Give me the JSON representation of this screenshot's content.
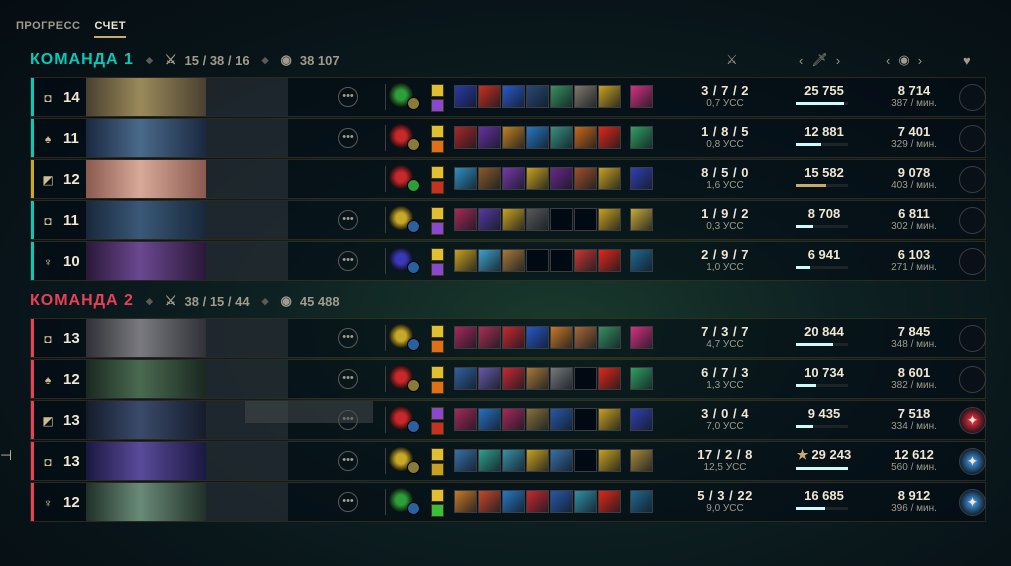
{
  "tabs": [
    {
      "label": "ПРОГРЕСС",
      "active": false
    },
    {
      "label": "СЧЕТ",
      "active": true
    }
  ],
  "teams": [
    {
      "name": "КОМАНДА 1",
      "color": "#0ac8b9",
      "kda": "15 / 38 / 16",
      "gold": "38 107",
      "players": [
        {
          "role": "top-icon",
          "role_glyph": "◘",
          "level": "14",
          "keystone": "#2d9e3a",
          "sub": "#8a7a3a",
          "spells": [
            "#e0c030",
            "#8848d0"
          ],
          "items": [
            "#2a3aa8",
            "#c83020",
            "#2a58c8",
            "#284878",
            "#389060",
            "#807868",
            "#c8a020",
            "#d83080"
          ],
          "kda": "3 / 7 / 2",
          "cs": "0,7 УСС",
          "damage": "25 755",
          "dmg_frac": 0.92,
          "gold": "8 714",
          "gold_pm": "387 / мин.",
          "honor": "",
          "portrait": [
            "#9a8a5a",
            "#4a4030"
          ]
        },
        {
          "role": "jungle-icon",
          "role_glyph": "♠",
          "level": "11",
          "keystone": "#c8282a",
          "sub": "#8a7a3a",
          "spells": [
            "#e0c030",
            "#e07018"
          ],
          "items": [
            "#a82828",
            "#6830a0",
            "#c08020",
            "#2878c0",
            "#389080",
            "#c86818",
            "#e02818",
            "#30a060"
          ],
          "kda": "1 / 8 / 5",
          "cs": "0,8 УСС",
          "damage": "12 881",
          "dmg_frac": 0.48,
          "gold": "7 401",
          "gold_pm": "329 / мин.",
          "honor": "",
          "portrait": [
            "#4a6a8a",
            "#1a2840"
          ]
        },
        {
          "role": "mid-icon",
          "role_glyph": "◩",
          "level": "12",
          "keystone": "#c8282a",
          "sub": "#2d9e3a",
          "spells": [
            "#e0c030",
            "#c83020"
          ],
          "items": [
            "#3090c0",
            "#8a5a28",
            "#7838a8",
            "#c8a020",
            "#6a2888",
            "#a05028",
            "#c8a020",
            "#3040b0"
          ],
          "kda": "8 / 5 / 0",
          "cs": "1,6 УСС",
          "damage": "15 582",
          "dmg_frac": 0.58,
          "gold": "9 078",
          "gold_pm": "403 / мин.",
          "honor": "",
          "portrait": [
            "#d8a898",
            "#8a5a50"
          ],
          "bar": "#c8aa1e",
          "gold_bar": true
        },
        {
          "role": "top-icon",
          "role_glyph": "◘",
          "level": "11",
          "keystone": "#c8a828",
          "sub": "#2860a0",
          "spells": [
            "#e0c030",
            "#8848d0"
          ],
          "items": [
            "#a82858",
            "#5838a0",
            "#c8a020",
            "#585858",
            "",
            "",
            "#c8a020",
            "#c8a838"
          ],
          "kda": "1 / 9 / 2",
          "cs": "0,3 УСС",
          "damage": "8 708",
          "dmg_frac": 0.32,
          "gold": "6 811",
          "gold_pm": "302 / мин.",
          "honor": "",
          "portrait": [
            "#3a5878",
            "#18283a"
          ]
        },
        {
          "role": "support-icon",
          "role_glyph": "♆",
          "level": "10",
          "keystone": "#3838b8",
          "sub": "#2860a0",
          "spells": [
            "#e0c030",
            "#8848d0"
          ],
          "items": [
            "#c8a020",
            "#40a0c8",
            "#a87838",
            "",
            "",
            "#c83830",
            "#e02818",
            "#206890"
          ],
          "kda": "2 / 9 / 7",
          "cs": "1,0 УСС",
          "damage": "6 941",
          "dmg_frac": 0.26,
          "gold": "6 103",
          "gold_pm": "271 / мин.",
          "honor": "",
          "portrait": [
            "#6a4890",
            "#2a1838"
          ]
        }
      ]
    },
    {
      "name": "КОМАНДА 2",
      "color": "#e84057",
      "kda": "38 / 15 / 44",
      "gold": "45 488",
      "players": [
        {
          "role": "top-icon",
          "role_glyph": "◘",
          "level": "13",
          "keystone": "#c8a828",
          "sub": "#2860a0",
          "spells": [
            "#e0c030",
            "#e07018"
          ],
          "items": [
            "#a82858",
            "#a83050",
            "#c82830",
            "#2858c8",
            "#c87828",
            "#a86838",
            "#389060",
            "#d83080"
          ],
          "kda": "7 / 3 / 7",
          "cs": "4,7 УСС",
          "damage": "20 844",
          "dmg_frac": 0.72,
          "gold": "7 845",
          "gold_pm": "348 / мин.",
          "honor": "",
          "portrait": [
            "#7a7a80",
            "#303038"
          ]
        },
        {
          "role": "jungle-icon",
          "role_glyph": "♠",
          "level": "12",
          "keystone": "#c8282a",
          "sub": "#8a7a3a",
          "spells": [
            "#e0c030",
            "#e07018"
          ],
          "items": [
            "#3060a0",
            "#6858a8",
            "#c82830",
            "#a87838",
            "#787878",
            "",
            "#e02818",
            "#30a060"
          ],
          "kda": "6 / 7 / 3",
          "cs": "1,3 УСС",
          "damage": "10 734",
          "dmg_frac": 0.38,
          "gold": "8 601",
          "gold_pm": "382 / мин.",
          "honor": "",
          "portrait": [
            "#4a6a50",
            "#1a2820"
          ]
        },
        {
          "role": "mid-icon",
          "role_glyph": "◩",
          "level": "13",
          "keystone": "#c8282a",
          "sub": "#2860a0",
          "spells": [
            "#8848d0",
            "#c83020"
          ],
          "items": [
            "#a82858",
            "#2870c0",
            "#a82858",
            "#8a7038",
            "#2858a8",
            "",
            "#c8a020",
            "#3040b0"
          ],
          "kda": "3 / 0 / 4",
          "cs": "7,0 УСС",
          "damage": "9 435",
          "dmg_frac": 0.33,
          "gold": "7 518",
          "gold_pm": "334 / мин.",
          "honor": "#c8283a",
          "portrait": [
            "#3a4a6a",
            "#141c2a"
          ]
        },
        {
          "role": "top-icon",
          "role_glyph": "◘",
          "level": "13",
          "keystone": "#c8a828",
          "sub": "#8a7a3a",
          "spells": [
            "#e0c030",
            "#c8a020"
          ],
          "items": [
            "#3870a8",
            "#30a090",
            "#3890a8",
            "#c8a020",
            "#3870a8",
            "",
            "#c8a020",
            "#a88838"
          ],
          "kda": "17 / 2 / 8",
          "cs": "12,5 УСС",
          "damage": "29 243",
          "dmg_frac": 1.0,
          "star": "★",
          "gold": "12 612",
          "gold_pm": "560 / мин.",
          "honor": "#3880c0",
          "portrait": [
            "#5a4a9a",
            "#1a1840"
          ]
        },
        {
          "role": "support-icon",
          "role_glyph": "♆",
          "level": "12",
          "keystone": "#2d9e3a",
          "sub": "#2860a0",
          "spells": [
            "#e0c030",
            "#38c038"
          ],
          "items": [
            "#c87828",
            "#c84828",
            "#2878c0",
            "#c82830",
            "#2858a8",
            "#3090a8",
            "#e02818",
            "#206890"
          ],
          "kda": "5 / 3 / 22",
          "cs": "9,0 УСС",
          "damage": "16 685",
          "dmg_frac": 0.56,
          "gold": "8 912",
          "gold_pm": "396 / мин.",
          "honor": "#3880c0",
          "portrait": [
            "#6a8a78",
            "#203028"
          ]
        }
      ]
    }
  ],
  "columns": {
    "kda_icon": "swords-icon",
    "damage_icon": "sword-icon",
    "gold_icon": "coins-icon",
    "honor_icon": "heart-icon",
    "arrow_left": "‹",
    "arrow_right": "›"
  },
  "edge_glyph": "⊣"
}
